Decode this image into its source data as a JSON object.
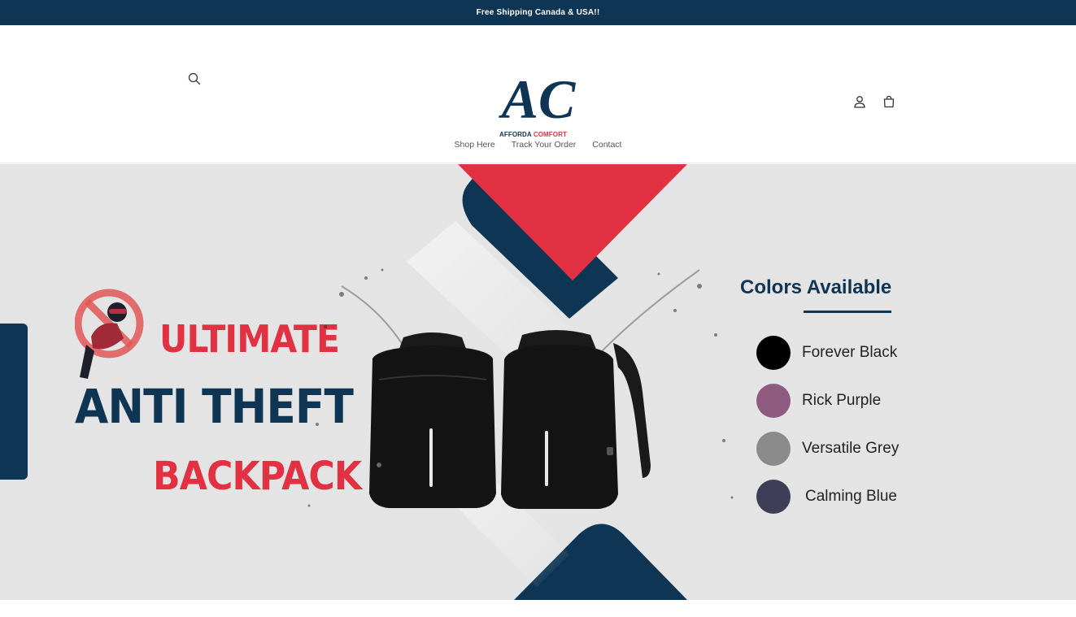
{
  "announcement": {
    "text": "Free Shipping Canada & USA!!"
  },
  "header": {
    "logo": {
      "monogram": "AC",
      "word1": "AFFORDA",
      "word2": "COMFORT"
    },
    "nav": [
      {
        "label": "Shop Here"
      },
      {
        "label": "Track Your Order"
      },
      {
        "label": "Contact"
      }
    ]
  },
  "hero": {
    "line1": "ULTIMATE",
    "line2": "ANTI THEFT",
    "line3": "BACKPACK",
    "colors_title": "Colors Available",
    "colors": [
      {
        "name": "Forever Black",
        "hex": "#000000"
      },
      {
        "name": "Rick Purple",
        "hex": "#8e5a80"
      },
      {
        "name": "Versatile Grey",
        "hex": "#8a8a8a"
      },
      {
        "name": "Calming Blue",
        "hex": "#3e3e58"
      }
    ]
  },
  "theme": {
    "navy": "#0e3553",
    "red": "#e23142",
    "hero_bg": "#e4e4e4"
  }
}
